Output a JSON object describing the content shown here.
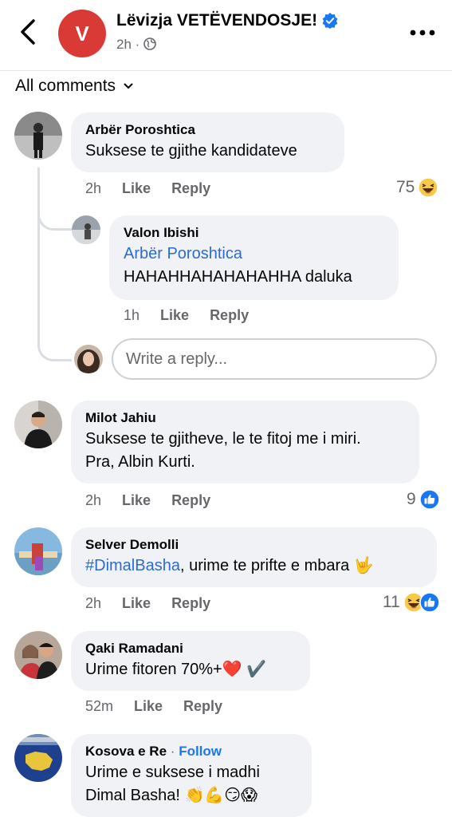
{
  "header": {
    "page_name": "Lëvizja VETËVENDOSJE!",
    "avatar_letter": "V",
    "time": "2h",
    "separator": "·"
  },
  "filter": {
    "label": "All comments"
  },
  "comments": [
    {
      "author": "Arbër Poroshtica",
      "text": "Suksese te gjithe kandidateve",
      "time": "2h",
      "like": "Like",
      "reply": "Reply",
      "reaction_count": "75"
    },
    {
      "author": "Valon Ibishi",
      "mention": "Arbër Poroshtica",
      "text": "HAHAHHAHAHAHAHHA daluka",
      "time": "1h",
      "like": "Like",
      "reply": "Reply"
    },
    {
      "author": "Milot Jahiu",
      "text_line1": "Suksese te gjitheve, le te fitoj me i miri.",
      "text_line2": "Pra, Albin Kurti.",
      "time": "2h",
      "like": "Like",
      "reply": "Reply",
      "reaction_count": "9"
    },
    {
      "author": "Selver Demolli",
      "mention": "#DimalBasha",
      "text": ", urime te prifte e mbara 🤟",
      "time": "2h",
      "like": "Like",
      "reply": "Reply",
      "reaction_count": "11"
    },
    {
      "author": "Qaki Ramadani",
      "text": "Urime fitoren 70%+❤️ ✔️",
      "time": "52m",
      "like": "Like",
      "reply": "Reply"
    },
    {
      "author": "Kosova e Re",
      "separator": "·",
      "follow": "Follow",
      "text_line1": "Urime e suksese i madhi",
      "text_line2": "Dimal Basha! 👏💪😏😱"
    }
  ],
  "reply_box": {
    "placeholder": "Write a reply..."
  },
  "colors": {
    "accent": "#1877f2",
    "brand_red": "#d93a36",
    "bubble": "#f0f2f5",
    "secondary_text": "#65676b"
  }
}
